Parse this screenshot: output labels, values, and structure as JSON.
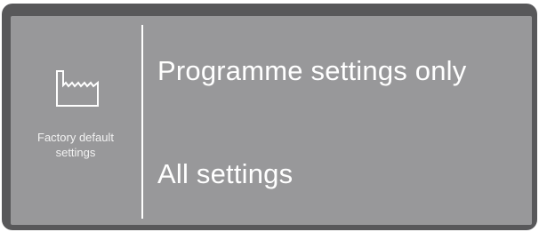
{
  "menu": {
    "icon": "factory-icon",
    "label_line1": "Factory default",
    "label_line2": "settings"
  },
  "options": [
    {
      "label": "Programme settings only"
    },
    {
      "label": "All settings"
    }
  ],
  "colors": {
    "frame": "#58585a",
    "screen": "#98989a",
    "text": "#ffffff"
  }
}
